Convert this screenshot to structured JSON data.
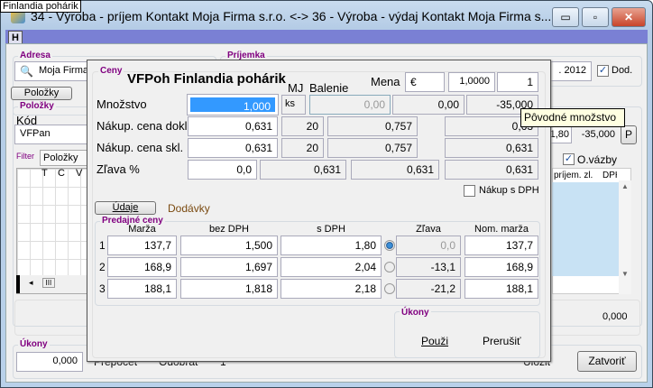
{
  "tooltip_top": "Finlandia pohárik",
  "window": {
    "title": "34 - Výroba - príjem   Kontakt Moja Firma s.r.o.  <-> 36 - Výroba - výdaj   Kontakt Moja Firma s...",
    "minimize": "▭",
    "maximize": "▫",
    "close": "✕",
    "h_button": "H"
  },
  "adresa": {
    "label": "Adresa",
    "value": "Moja Firma"
  },
  "prijemka": {
    "label": "Príjemka",
    "date": ". 2012",
    "dod_label": "Dod.",
    "dod_checked": true
  },
  "polozky_button": "Položky",
  "polozky": {
    "label": "Položky",
    "kod_label": "Kód",
    "kod_value": "VFPan",
    "filter_label": "Filter",
    "tab": "Položky",
    "grid_cols": [
      "T",
      "C",
      "V"
    ],
    "right_cols": [
      "príjem. zl.",
      "DPH"
    ],
    "val1": "1,80",
    "val2": "-35,000",
    "p_button": "P",
    "ovazby_label": "O.vázby",
    "ovazby_checked": true,
    "total": "0,000"
  },
  "ukony": {
    "label": "Úkony",
    "value": "0,000",
    "prepocet": "Prepočet",
    "odobrat": "Odobrať",
    "num": "1",
    "ulozit": "Uložiť",
    "zatvorit": "Zatvoriť"
  },
  "dialog": {
    "group_label": "Ceny",
    "title": "VFPoh Finlandia pohárik",
    "mena_label": "Mena",
    "mena_value": "€",
    "kurz": "1,0000",
    "mnozstvo_kurz": "1",
    "mj_label": "MJ",
    "balenie_label": "Balenie",
    "mnozstvo": {
      "label": "Množstvo",
      "value": "1,000",
      "mj": "ks",
      "balenie": "0,00",
      "c4": "0,00",
      "c5": "-35,000"
    },
    "dokl": {
      "label": "Nákup. cena dokl.",
      "value": "0,631",
      "c2": "20",
      "c3": "0,757",
      "c5": "0,63"
    },
    "skl": {
      "label": "Nákup. cena skl.",
      "value": "0,631",
      "c2": "20",
      "c3": "0,757",
      "c5": "0,631"
    },
    "zlava": {
      "label": "Zľava %",
      "value": "0,0",
      "c2": "0,631",
      "c3": "0,631",
      "c5": "0,631"
    },
    "nakup_s_dph": "Nákup s DPH",
    "udaje_button": "Údaje",
    "dodavky_tab": "Dodávky",
    "predajne": {
      "label": "Predajné ceny",
      "headers": [
        "Marža",
        "bez DPH",
        "s DPH",
        "Zľava",
        "Nom. marža"
      ],
      "rows": [
        {
          "n": "1",
          "marza": "137,7",
          "bez": "1,500",
          "s": "1,80",
          "zlava": "0,0",
          "nom": "137,7",
          "selected": true
        },
        {
          "n": "2",
          "marza": "168,9",
          "bez": "1,697",
          "s": "2,04",
          "zlava": "-13,1",
          "nom": "168,9",
          "selected": false
        },
        {
          "n": "3",
          "marza": "188,1",
          "bez": "1,818",
          "s": "2,18",
          "zlava": "-21,2",
          "nom": "188,1",
          "selected": false
        }
      ]
    },
    "ukony_label": "Úkony",
    "pouzi": "Použi",
    "prerusit": "Prerušiť"
  },
  "tooltip": "Pôvodné množstvo"
}
